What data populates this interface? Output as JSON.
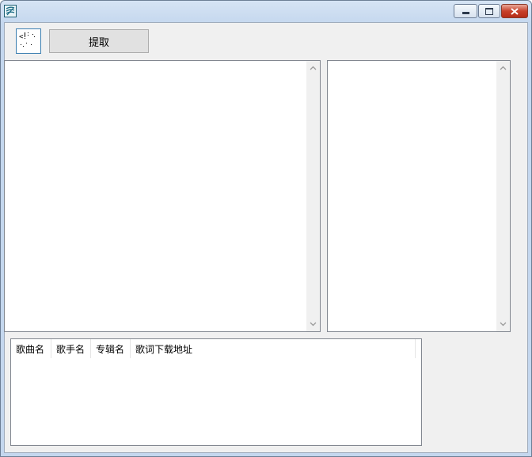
{
  "window": {
    "icons": {
      "app": "app-icon",
      "minimize": "minimize-icon",
      "maximize": "maximize-icon",
      "close": "close-icon"
    }
  },
  "toolbar": {
    "tool_icon": "dotted-grid-icon",
    "extract_label": "提取"
  },
  "list": {
    "columns": [
      "歌曲名",
      "歌手名",
      "专辑名",
      "歌词下载地址"
    ]
  },
  "colors": {
    "client_bg": "#f0f0f0",
    "titlebar": "#c4d7ee",
    "close_button": "#c8412a",
    "border": "#828790"
  }
}
